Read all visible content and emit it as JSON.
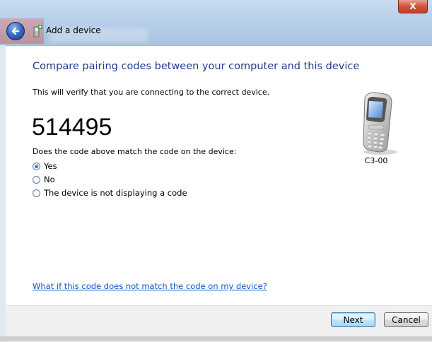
{
  "window": {
    "title": "Add a device",
    "close_glyph": "X",
    "back_icon": "back-arrow-icon",
    "app_icon": "add-device-icon"
  },
  "dialog": {
    "main_instruction": "Compare pairing codes between your computer and this device",
    "subtext": "This will verify that you are connecting to the correct device.",
    "pairing_code": "514495",
    "question": "Does the code above match the code on the device:",
    "options": [
      {
        "label": "Yes",
        "selected": true
      },
      {
        "label": "No",
        "selected": false
      },
      {
        "label": "The device is not displaying a code",
        "selected": false
      }
    ],
    "device": {
      "icon": "mobile-phone-icon",
      "name": "C3-00"
    },
    "help_link": "What if this code does not match the code on my device?"
  },
  "footer": {
    "next_label": "Next",
    "cancel_label": "Cancel"
  },
  "colors": {
    "instruction_text": "#1e3d8a",
    "link": "#0b56c8",
    "default_button_border": "#3c7fb1"
  }
}
